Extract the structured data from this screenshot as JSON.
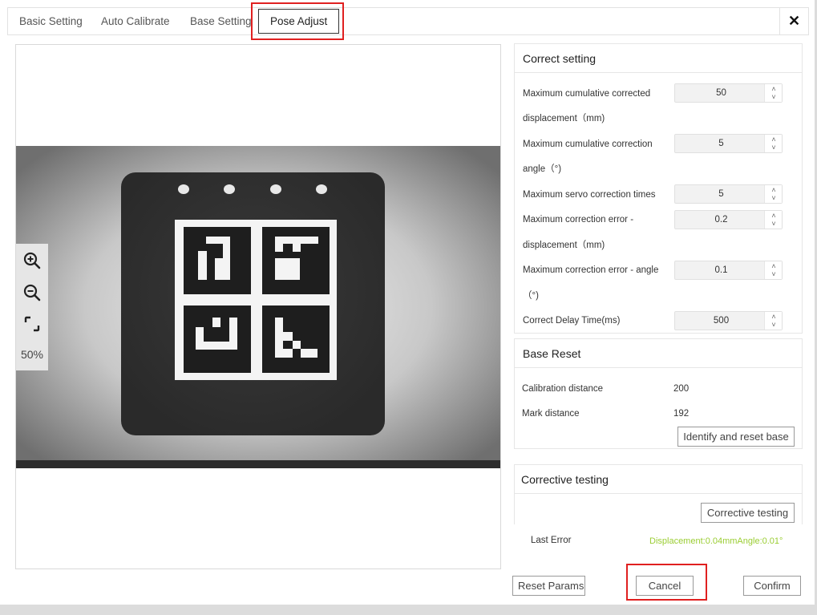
{
  "tabs": [
    {
      "label": "Basic Setting"
    },
    {
      "label": "Auto Calibrate"
    },
    {
      "label": "Base Setting"
    },
    {
      "label": "Pose Adjust"
    }
  ],
  "close_glyph": "✕",
  "viewer": {
    "zoom": "50%"
  },
  "correct_setting": {
    "title": "Correct setting",
    "rows": [
      {
        "label_line1": "Maximum cumulative corrected",
        "label_line2": "displacement（mm)",
        "value": "50"
      },
      {
        "label_line1": "Maximum cumulative correction",
        "label_line2": "angle（°)",
        "value": "5"
      },
      {
        "label_line1": "Maximum servo correction times",
        "label_line2": "",
        "value": "5"
      },
      {
        "label_line1": "Maximum correction error -",
        "label_line2": "displacement（mm)",
        "value": "0.2"
      },
      {
        "label_line1": "Maximum correction error - angle",
        "label_line2": "（°)",
        "value": "0.1"
      },
      {
        "label_line1": "Correct Delay Time(ms)",
        "label_line2": "",
        "value": "500"
      }
    ]
  },
  "base_reset": {
    "title": "Base Reset",
    "calibration_distance_label": "Calibration distance",
    "calibration_distance_value": "200",
    "mark_distance_label": "Mark distance",
    "mark_distance_value": "192",
    "identify_button": "Identify and reset base"
  },
  "corrective_testing": {
    "title": "Corrective testing",
    "button": "Corrective testing",
    "last_error_label": "Last Error",
    "last_error_value": "Displacement:0.04mmAngle:0.01°"
  },
  "footer": {
    "reset": "Reset Params",
    "cancel": "Cancel",
    "confirm": "Confirm"
  },
  "colors": {
    "highlight": "#e02020",
    "last_error": "#9acd32"
  }
}
